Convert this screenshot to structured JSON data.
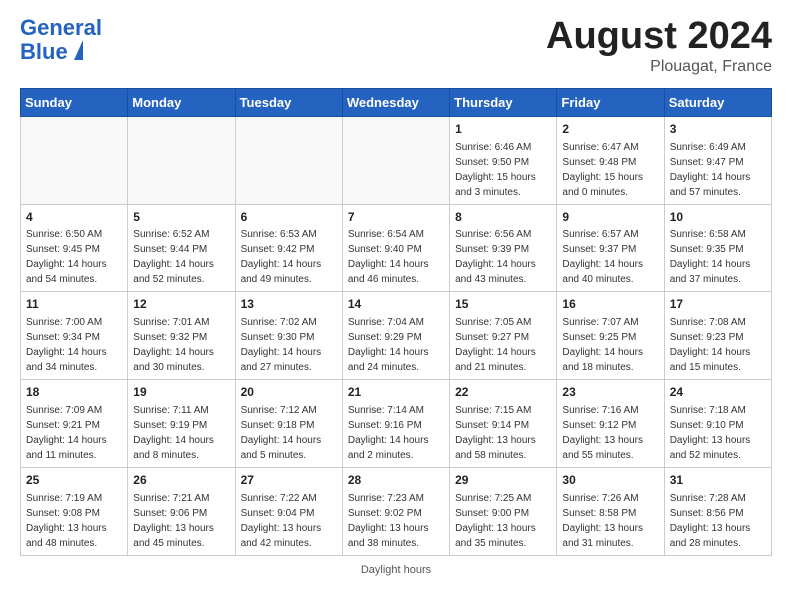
{
  "header": {
    "logo_line1": "General",
    "logo_line2": "Blue",
    "month": "August 2024",
    "location": "Plouagat, France"
  },
  "days_of_week": [
    "Sunday",
    "Monday",
    "Tuesday",
    "Wednesday",
    "Thursday",
    "Friday",
    "Saturday"
  ],
  "weeks": [
    [
      {
        "day": "",
        "info": ""
      },
      {
        "day": "",
        "info": ""
      },
      {
        "day": "",
        "info": ""
      },
      {
        "day": "",
        "info": ""
      },
      {
        "day": "1",
        "info": "Sunrise: 6:46 AM\nSunset: 9:50 PM\nDaylight: 15 hours\nand 3 minutes."
      },
      {
        "day": "2",
        "info": "Sunrise: 6:47 AM\nSunset: 9:48 PM\nDaylight: 15 hours\nand 0 minutes."
      },
      {
        "day": "3",
        "info": "Sunrise: 6:49 AM\nSunset: 9:47 PM\nDaylight: 14 hours\nand 57 minutes."
      }
    ],
    [
      {
        "day": "4",
        "info": "Sunrise: 6:50 AM\nSunset: 9:45 PM\nDaylight: 14 hours\nand 54 minutes."
      },
      {
        "day": "5",
        "info": "Sunrise: 6:52 AM\nSunset: 9:44 PM\nDaylight: 14 hours\nand 52 minutes."
      },
      {
        "day": "6",
        "info": "Sunrise: 6:53 AM\nSunset: 9:42 PM\nDaylight: 14 hours\nand 49 minutes."
      },
      {
        "day": "7",
        "info": "Sunrise: 6:54 AM\nSunset: 9:40 PM\nDaylight: 14 hours\nand 46 minutes."
      },
      {
        "day": "8",
        "info": "Sunrise: 6:56 AM\nSunset: 9:39 PM\nDaylight: 14 hours\nand 43 minutes."
      },
      {
        "day": "9",
        "info": "Sunrise: 6:57 AM\nSunset: 9:37 PM\nDaylight: 14 hours\nand 40 minutes."
      },
      {
        "day": "10",
        "info": "Sunrise: 6:58 AM\nSunset: 9:35 PM\nDaylight: 14 hours\nand 37 minutes."
      }
    ],
    [
      {
        "day": "11",
        "info": "Sunrise: 7:00 AM\nSunset: 9:34 PM\nDaylight: 14 hours\nand 34 minutes."
      },
      {
        "day": "12",
        "info": "Sunrise: 7:01 AM\nSunset: 9:32 PM\nDaylight: 14 hours\nand 30 minutes."
      },
      {
        "day": "13",
        "info": "Sunrise: 7:02 AM\nSunset: 9:30 PM\nDaylight: 14 hours\nand 27 minutes."
      },
      {
        "day": "14",
        "info": "Sunrise: 7:04 AM\nSunset: 9:29 PM\nDaylight: 14 hours\nand 24 minutes."
      },
      {
        "day": "15",
        "info": "Sunrise: 7:05 AM\nSunset: 9:27 PM\nDaylight: 14 hours\nand 21 minutes."
      },
      {
        "day": "16",
        "info": "Sunrise: 7:07 AM\nSunset: 9:25 PM\nDaylight: 14 hours\nand 18 minutes."
      },
      {
        "day": "17",
        "info": "Sunrise: 7:08 AM\nSunset: 9:23 PM\nDaylight: 14 hours\nand 15 minutes."
      }
    ],
    [
      {
        "day": "18",
        "info": "Sunrise: 7:09 AM\nSunset: 9:21 PM\nDaylight: 14 hours\nand 11 minutes."
      },
      {
        "day": "19",
        "info": "Sunrise: 7:11 AM\nSunset: 9:19 PM\nDaylight: 14 hours\nand 8 minutes."
      },
      {
        "day": "20",
        "info": "Sunrise: 7:12 AM\nSunset: 9:18 PM\nDaylight: 14 hours\nand 5 minutes."
      },
      {
        "day": "21",
        "info": "Sunrise: 7:14 AM\nSunset: 9:16 PM\nDaylight: 14 hours\nand 2 minutes."
      },
      {
        "day": "22",
        "info": "Sunrise: 7:15 AM\nSunset: 9:14 PM\nDaylight: 13 hours\nand 58 minutes."
      },
      {
        "day": "23",
        "info": "Sunrise: 7:16 AM\nSunset: 9:12 PM\nDaylight: 13 hours\nand 55 minutes."
      },
      {
        "day": "24",
        "info": "Sunrise: 7:18 AM\nSunset: 9:10 PM\nDaylight: 13 hours\nand 52 minutes."
      }
    ],
    [
      {
        "day": "25",
        "info": "Sunrise: 7:19 AM\nSunset: 9:08 PM\nDaylight: 13 hours\nand 48 minutes."
      },
      {
        "day": "26",
        "info": "Sunrise: 7:21 AM\nSunset: 9:06 PM\nDaylight: 13 hours\nand 45 minutes."
      },
      {
        "day": "27",
        "info": "Sunrise: 7:22 AM\nSunset: 9:04 PM\nDaylight: 13 hours\nand 42 minutes."
      },
      {
        "day": "28",
        "info": "Sunrise: 7:23 AM\nSunset: 9:02 PM\nDaylight: 13 hours\nand 38 minutes."
      },
      {
        "day": "29",
        "info": "Sunrise: 7:25 AM\nSunset: 9:00 PM\nDaylight: 13 hours\nand 35 minutes."
      },
      {
        "day": "30",
        "info": "Sunrise: 7:26 AM\nSunset: 8:58 PM\nDaylight: 13 hours\nand 31 minutes."
      },
      {
        "day": "31",
        "info": "Sunrise: 7:28 AM\nSunset: 8:56 PM\nDaylight: 13 hours\nand 28 minutes."
      }
    ]
  ],
  "footer": "Daylight hours"
}
